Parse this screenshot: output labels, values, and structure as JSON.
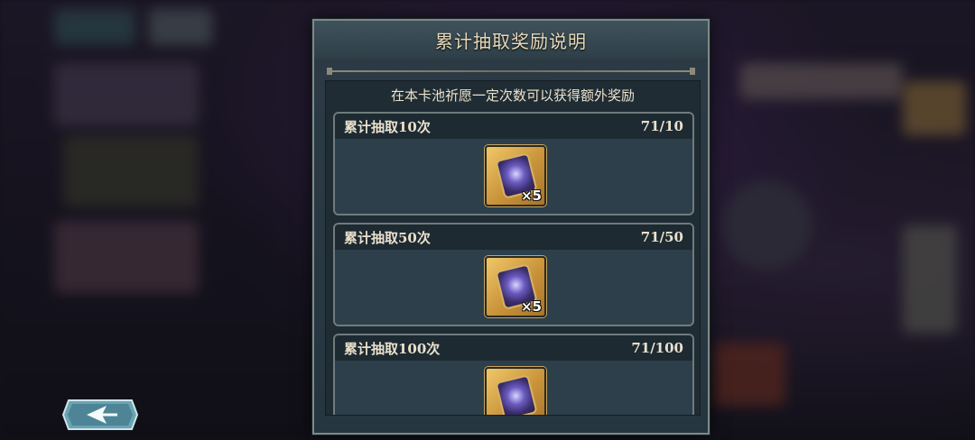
{
  "panel": {
    "title": "累计抽取奖励说明",
    "subtitle": "在本卡池祈愿一定次数可以获得额外奖励"
  },
  "milestones": [
    {
      "label": "累计抽取10次",
      "progress": "71/10",
      "reward_icon": "summon-ticket-icon",
      "reward_count": "×5"
    },
    {
      "label": "累计抽取50次",
      "progress": "71/50",
      "reward_icon": "summon-ticket-icon",
      "reward_count": "×5"
    },
    {
      "label": "累计抽取100次",
      "progress": "71/100",
      "reward_icon": "summon-ticket-icon",
      "reward_count": ""
    }
  ],
  "back_button": {
    "icon": "back-arrow-icon"
  },
  "colors": {
    "title_text": "#e8d9b8",
    "reward_frame": "#f0c868",
    "panel_bg": "#2c3b45"
  }
}
